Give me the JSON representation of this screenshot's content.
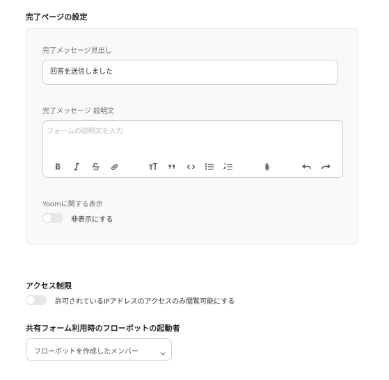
{
  "completion_page": {
    "section_title": "完了ページの設定",
    "heading_label": "完了メッセージ見出し",
    "heading_value": "回答を送信しました",
    "description_label": "完了メッセージ 説明文",
    "description_placeholder": "フォームの説明文を入力",
    "editor_toolbar": [
      "bold-icon",
      "italic-icon",
      "strikethrough-icon",
      "link-icon",
      "text-size-icon",
      "quote-icon",
      "code-icon",
      "bullet-list-icon",
      "numbered-list-icon",
      "attachment-icon",
      "undo-icon",
      "redo-icon"
    ],
    "yoom_label": "Yoomに関する表示",
    "yoom_toggle_text": "非表示にする",
    "yoom_toggle_on": false
  },
  "access": {
    "section_title": "アクセス制限",
    "toggle_text": "許可されているIPアドレスのアクセスのみ閲覧可能にする",
    "toggle_on": false
  },
  "flowbot": {
    "section_title": "共有フォーム利用時のフローボットの起動者",
    "selected": "フローボットを作成したメンバー"
  }
}
